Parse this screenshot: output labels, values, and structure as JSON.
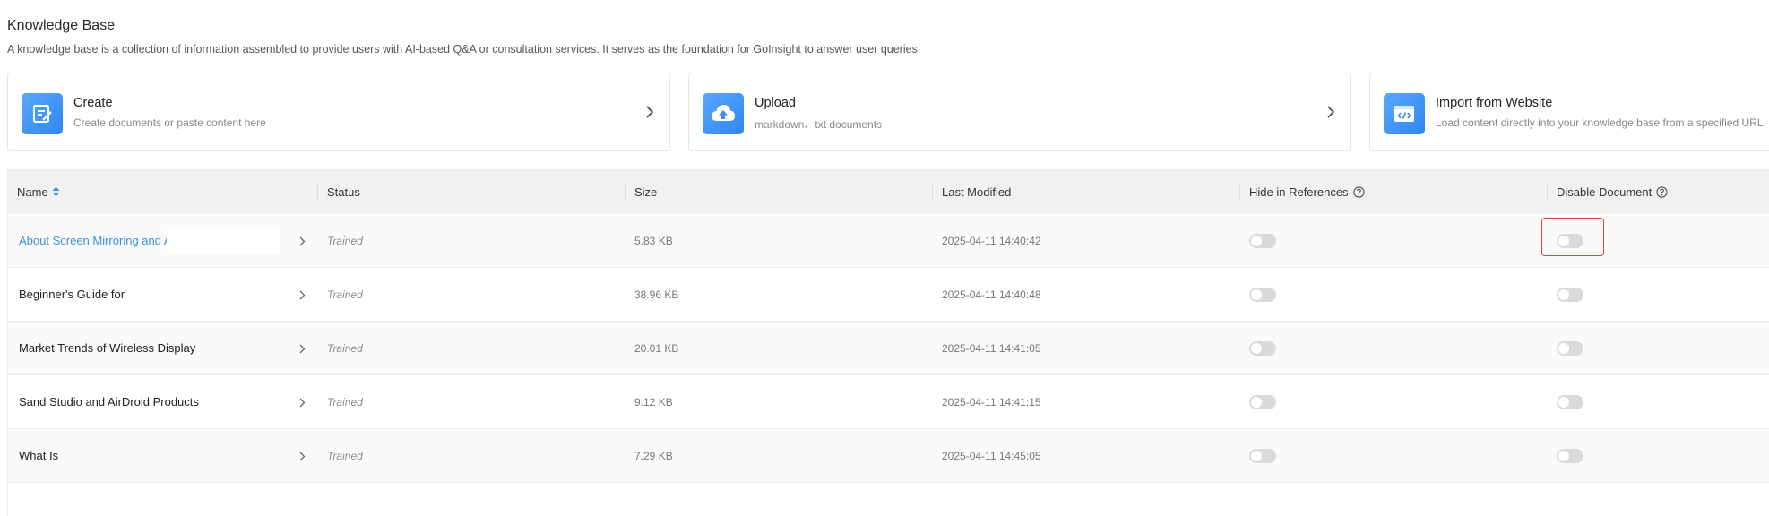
{
  "page": {
    "title": "Knowledge Base",
    "description": "A knowledge base is a collection of information assembled to provide users with AI-based Q&A or consultation services. It serves as the foundation for GoInsight to answer user queries."
  },
  "cards": [
    {
      "title": "Create",
      "subtitle": "Create documents or paste content here",
      "icon": "edit-document-icon"
    },
    {
      "title": "Upload",
      "subtitle": "markdown、txt documents",
      "icon": "cloud-upload-icon"
    },
    {
      "title": "Import from Website",
      "subtitle": "Load content directly into your knowledge base from a specified URL",
      "icon": "web-code-icon"
    }
  ],
  "table": {
    "columns": [
      "Name",
      "Status",
      "Size",
      "Last Modified",
      "Hide in References",
      "Disable Document"
    ],
    "rows": [
      {
        "name": "About Screen Mirroring and A",
        "status": "Trained",
        "size": "5.83 KB",
        "modified": "2025-04-11 14:40:42",
        "hide_in_references": false,
        "disabled": false
      },
      {
        "name": "Beginner's Guide for",
        "status": "Trained",
        "size": "38.96 KB",
        "modified": "2025-04-11 14:40:48",
        "hide_in_references": false,
        "disabled": false
      },
      {
        "name": "Market Trends of Wireless Display",
        "status": "Trained",
        "size": "20.01 KB",
        "modified": "2025-04-11 14:41:05",
        "hide_in_references": false,
        "disabled": false
      },
      {
        "name": "Sand Studio and AirDroid Products",
        "status": "Trained",
        "size": "9.12 KB",
        "modified": "2025-04-11 14:41:15",
        "hide_in_references": false,
        "disabled": false
      },
      {
        "name": "What Is",
        "status": "Trained",
        "size": "7.29 KB",
        "modified": "2025-04-11 14:45:05",
        "hide_in_references": false,
        "disabled": false
      }
    ]
  },
  "colors": {
    "accent": "#3d8fe6",
    "highlight": "#e0413b",
    "toggle_off": "#dadada"
  }
}
